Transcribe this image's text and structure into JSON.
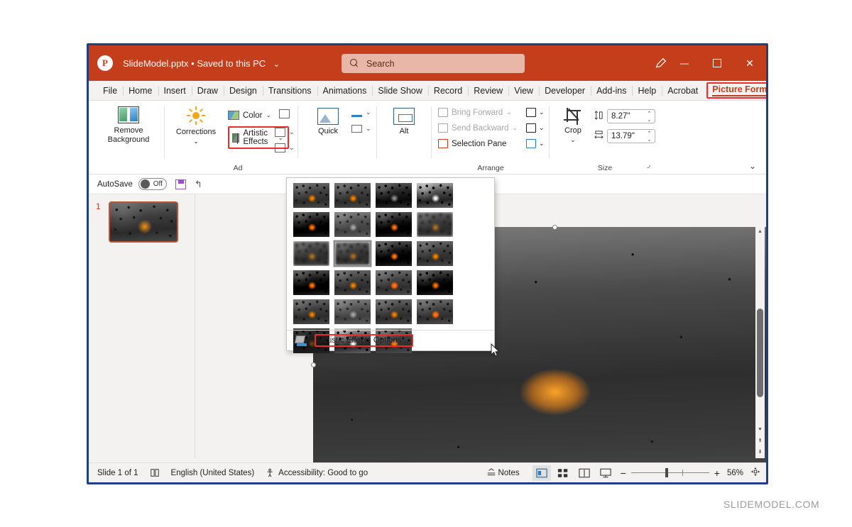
{
  "window": {
    "title": "SlideModel.pptx",
    "separator": "•",
    "save_state": "Saved to this PC",
    "logo_letter": "P",
    "search_placeholder": "Search",
    "controls": {
      "pen": "pen-icon",
      "minimize": "—",
      "maximize": "▢",
      "close": "✕"
    }
  },
  "tabs": [
    {
      "label": "File"
    },
    {
      "label": "Home"
    },
    {
      "label": "Insert"
    },
    {
      "label": "Draw"
    },
    {
      "label": "Design"
    },
    {
      "label": "Transitions"
    },
    {
      "label": "Animations"
    },
    {
      "label": "Slide Show"
    },
    {
      "label": "Record"
    },
    {
      "label": "Review"
    },
    {
      "label": "View"
    },
    {
      "label": "Developer"
    },
    {
      "label": "Add-ins"
    },
    {
      "label": "Help"
    },
    {
      "label": "Acrobat"
    }
  ],
  "context_tab": {
    "label": "Picture Format",
    "color": "#c43e1c",
    "highlight_color": "#ee2b2b"
  },
  "record_button": {
    "label": "record-button"
  },
  "more_tabs_chevron": "›",
  "ribbon": {
    "groups": [
      {
        "name": "Adjust",
        "label": "Ad"
      },
      {
        "name": "Picture Styles",
        "label": ""
      },
      {
        "name": "Accessibility",
        "label": ""
      },
      {
        "name": "Arrange",
        "label": "Arrange"
      },
      {
        "name": "Size",
        "label": "Size"
      }
    ],
    "remove_background": {
      "line1": "Remove",
      "line2": "Background"
    },
    "corrections": {
      "label": "Corrections",
      "chevron": "⌄"
    },
    "color": {
      "label": "Color",
      "chevron": "⌄"
    },
    "artistic_effects": {
      "label": "Artistic Effects",
      "chevron": "⌄",
      "highlighted": true
    },
    "transparency": {
      "chevron": "⌄"
    },
    "compress": {
      "chevron": "⌄"
    },
    "reset_picture": {
      "chevron": "⌄"
    },
    "quick_styles": {
      "label": "Quick"
    },
    "picture_border": {
      "chevron": "⌄"
    },
    "picture_effects": {
      "chevron": "⌄"
    },
    "alt_text": {
      "label": "Alt"
    },
    "arrange": {
      "bring_forward": "Bring Forward",
      "send_backward": "Send Backward",
      "selection_pane": "Selection Pane",
      "align": "align-icon",
      "group": "group-icon",
      "rotate": "rotate-icon",
      "chevron": "⌄"
    },
    "size": {
      "crop_label": "Crop",
      "crop_chevron": "⌄",
      "height_value": "8.27\"",
      "width_value": "13.79\"",
      "dialog_launcher": "⌏"
    },
    "collapse_chevron": "⌄"
  },
  "artistic_effects_dropdown": {
    "rows": [
      [
        {
          "name": "none",
          "style": "warm"
        },
        {
          "name": "marker",
          "style": "warm"
        },
        {
          "name": "pencil-grayscale",
          "style": "bw"
        },
        {
          "name": "pencil-sketch",
          "style": "bright"
        },
        {
          "name": "line-drawing",
          "style": "pix"
        }
      ],
      [
        {
          "name": "watercolor-sponge",
          "style": "light"
        },
        {
          "name": "film-grain",
          "style": "pix"
        },
        {
          "name": "mosaic-bubbles",
          "style": "blur"
        },
        {
          "name": "glass",
          "style": "blur"
        },
        {
          "name": "cement",
          "style": "dark",
          "selected": true
        }
      ],
      [
        {
          "name": "texturizer",
          "style": "pix"
        },
        {
          "name": "crisscross-etching",
          "style": "warm"
        },
        {
          "name": "pastels-smooth",
          "style": "pix"
        },
        {
          "name": "plastic-wrap",
          "style": "warm"
        },
        {
          "name": "cutout",
          "style": "glow"
        }
      ],
      [
        {
          "name": "photocopy",
          "style": "pix"
        },
        {
          "name": "paint-strokes",
          "style": "warm"
        },
        {
          "name": "paint-brush",
          "style": "light"
        },
        {
          "name": "glow-diffused",
          "style": "warm"
        },
        {
          "name": "blur",
          "style": "glow"
        }
      ],
      [
        {
          "name": "light-screen",
          "style": "dark"
        },
        {
          "name": "watercolor-sponge-2",
          "style": "bright"
        },
        {
          "name": "glow-edges",
          "style": "glow"
        }
      ]
    ],
    "options_label_pre": "Artistic ",
    "options_label_underlined": "E",
    "options_label_post": "ffects Options...",
    "options_label_full": "Artistic Effects Options..."
  },
  "quick_access": {
    "autosave_label": "AutoSave",
    "autosave_state": "Off",
    "save_icon": "save-icon",
    "undo_icon": "undo-icon"
  },
  "slide_panel": {
    "slide_number": "1"
  },
  "status_bar": {
    "slide_count": "Slide 1 of 1",
    "notes_icon": "notes-icon",
    "language": "English (United States)",
    "accessibility": "Accessibility: Good to go",
    "notes_label": "Notes",
    "views": [
      {
        "name": "normal-view",
        "active": true
      },
      {
        "name": "slide-sorter-view",
        "active": false
      },
      {
        "name": "reading-view",
        "active": false
      },
      {
        "name": "slide-show-view",
        "active": false
      }
    ],
    "zoom_out": "−",
    "zoom_in": "+",
    "zoom_level": "56%",
    "fit_slide_icon": "fit-to-window-icon"
  },
  "watermark": "SLIDEMODEL.COM",
  "colors": {
    "titlebar": "#c43e1c",
    "accent": "#c43e1c",
    "highlight": "#ee2b2b",
    "window_border": "#1f3f86",
    "chrome": "#f3f2f1"
  }
}
